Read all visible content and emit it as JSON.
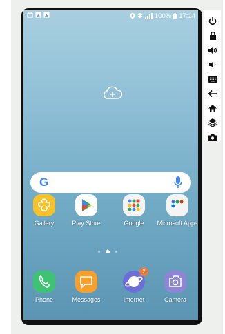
{
  "status": {
    "battery": "100%",
    "time": "17:14"
  },
  "search": {
    "logo": "G"
  },
  "apps_row1": [
    {
      "label": "Gallery"
    },
    {
      "label": "Play Store"
    },
    {
      "label": "Google"
    },
    {
      "label": "Microsoft Apps"
    }
  ],
  "dock": [
    {
      "label": "Phone"
    },
    {
      "label": "Messages"
    },
    {
      "label": "Internet",
      "badge": "2"
    },
    {
      "label": "Camera"
    }
  ],
  "toolbar": [
    "power-icon",
    "lock-icon",
    "volume-up-icon",
    "volume-down-icon",
    "keyboard-icon",
    "back-icon",
    "home-icon",
    "layers-icon",
    "screenshot-icon"
  ]
}
